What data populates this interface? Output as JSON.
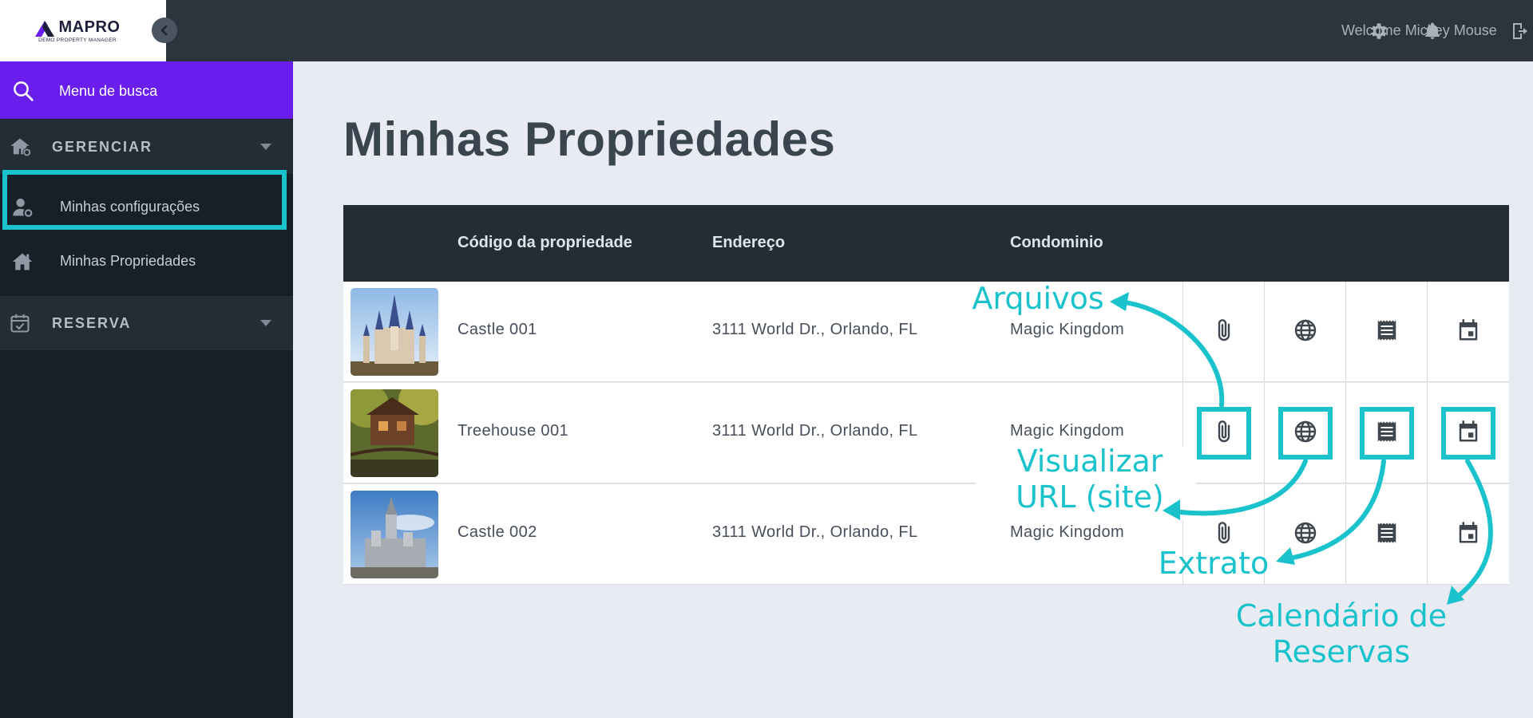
{
  "brand": {
    "name": "MAPRO",
    "tagline": "DEMO PROPERTY MANAGER"
  },
  "header": {
    "welcome": "Welcome Mickey Mouse",
    "icons": [
      "gear-icon",
      "bell-icon",
      "logout-icon"
    ]
  },
  "sidebar": {
    "search_placeholder": "Menu de busca",
    "sections": [
      {
        "label": "GERENCIAR",
        "icon": "house-gear-icon"
      },
      {
        "label": "RESERVA",
        "icon": "calendar-check-icon"
      }
    ],
    "items": [
      {
        "label": "Minhas configurações",
        "icon": "user-gear-icon"
      },
      {
        "label": "Minhas Propriedades",
        "icon": "home-icon"
      }
    ]
  },
  "main": {
    "title": "Minhas Propriedades",
    "table": {
      "headers": [
        "Código da propriedade",
        "Endereço",
        "Condominio"
      ],
      "rows": [
        {
          "code": "Castle 001",
          "address": "3111 World Dr., Orlando, FL",
          "condo": "Magic Kingdom"
        },
        {
          "code": "Treehouse 001",
          "address": "3111 World Dr., Orlando, FL",
          "condo": "Magic Kingdom"
        },
        {
          "code": "Castle 002",
          "address": "3111 World Dr., Orlando, FL",
          "condo": "Magic Kingdom"
        }
      ],
      "action_icons": [
        "paperclip-icon",
        "globe-icon",
        "receipt-icon",
        "calendar-icon"
      ]
    }
  },
  "annotations": {
    "arquivos": "Arquivos",
    "visualizar_line1": "Visualizar",
    "visualizar_line2": "URL (site)",
    "extrato": "Extrato",
    "calendario_line1": "Calendário de",
    "calendario_line2": "Reservas"
  },
  "colors": {
    "accent": "#1ac3cc",
    "search_bar": "#6a1eee",
    "topbar": "#2c353e",
    "sidebar": "#152029",
    "table_header": "#222d36"
  }
}
